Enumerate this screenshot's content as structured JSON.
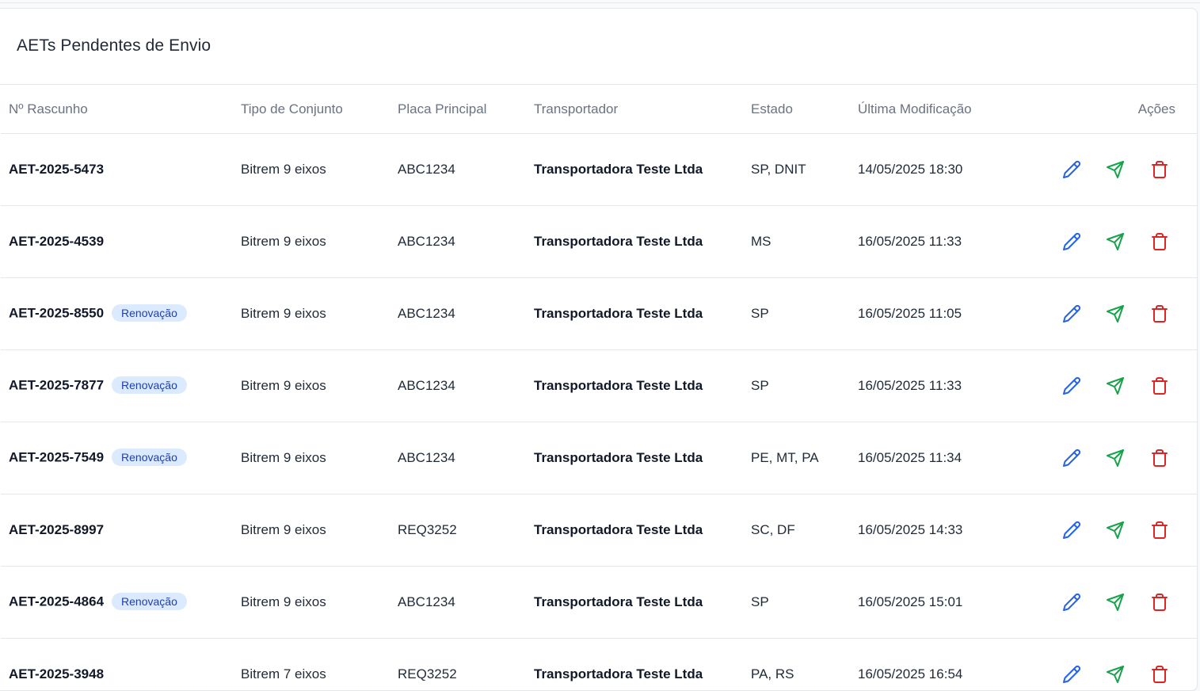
{
  "title": "AETs Pendentes de Envio",
  "columns": {
    "draft": "Nº Rascunho",
    "type": "Tipo de Conjunto",
    "plate": "Placa Principal",
    "carrier": "Transportador",
    "state": "Estado",
    "modified": "Última Modificação",
    "actions": "Ações"
  },
  "colors": {
    "edit": "#2563eb",
    "send": "#16a34a",
    "delete": "#dc2626",
    "badge_bg": "#dbeafe",
    "badge_text": "#1e40af"
  },
  "icons": {
    "edit": "pencil-icon",
    "send": "send-icon",
    "delete": "trash-icon"
  },
  "rows": [
    {
      "draft": "AET-2025-5473",
      "badge": "",
      "type": "Bitrem 9 eixos",
      "plate": "ABC1234",
      "carrier": "Transportadora Teste Ltda",
      "state": "SP, DNIT",
      "modified": "14/05/2025 18:30"
    },
    {
      "draft": "AET-2025-4539",
      "badge": "",
      "type": "Bitrem 9 eixos",
      "plate": "ABC1234",
      "carrier": "Transportadora Teste Ltda",
      "state": "MS",
      "modified": "16/05/2025 11:33"
    },
    {
      "draft": "AET-2025-8550",
      "badge": "Renovação",
      "type": "Bitrem 9 eixos",
      "plate": "ABC1234",
      "carrier": "Transportadora Teste Ltda",
      "state": "SP",
      "modified": "16/05/2025 11:05"
    },
    {
      "draft": "AET-2025-7877",
      "badge": "Renovação",
      "type": "Bitrem 9 eixos",
      "plate": "ABC1234",
      "carrier": "Transportadora Teste Ltda",
      "state": "SP",
      "modified": "16/05/2025 11:33"
    },
    {
      "draft": "AET-2025-7549",
      "badge": "Renovação",
      "type": "Bitrem 9 eixos",
      "plate": "ABC1234",
      "carrier": "Transportadora Teste Ltda",
      "state": "PE, MT, PA",
      "modified": "16/05/2025 11:34"
    },
    {
      "draft": "AET-2025-8997",
      "badge": "",
      "type": "Bitrem 9 eixos",
      "plate": "REQ3252",
      "carrier": "Transportadora Teste Ltda",
      "state": "SC, DF",
      "modified": "16/05/2025 14:33"
    },
    {
      "draft": "AET-2025-4864",
      "badge": "Renovação",
      "type": "Bitrem 9 eixos",
      "plate": "ABC1234",
      "carrier": "Transportadora Teste Ltda",
      "state": "SP",
      "modified": "16/05/2025 15:01"
    },
    {
      "draft": "AET-2025-3948",
      "badge": "",
      "type": "Bitrem 7 eixos",
      "plate": "REQ3252",
      "carrier": "Transportadora Teste Ltda",
      "state": "PA, RS",
      "modified": "16/05/2025 16:54"
    }
  ]
}
